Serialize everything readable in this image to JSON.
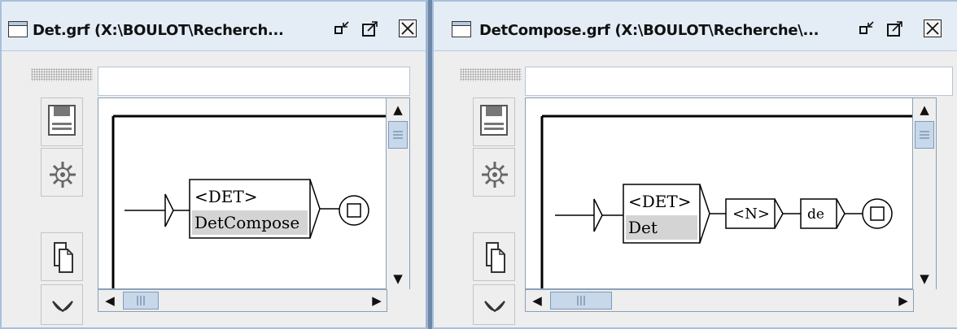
{
  "windows": [
    {
      "title": "Det.grf (X:\\BOULOT\\Recherch...",
      "controls": {
        "iconify": "▫↙",
        "maximize": "↗",
        "close": "×"
      },
      "graph": {
        "box_lines": [
          "<DET>",
          "DetCompose"
        ],
        "highlighted_line": "DetCompose"
      }
    },
    {
      "title": "DetCompose.grf (X:\\BOULOT\\Recherche\\...",
      "controls": {
        "iconify": "▫↙",
        "maximize": "↗",
        "close": "×"
      },
      "graph": {
        "box1_lines": [
          "<DET>",
          "Det"
        ],
        "highlighted_line": "Det",
        "box2": "<N>",
        "box3": "de"
      }
    }
  ],
  "toolbar": {
    "buttons": [
      "save-icon",
      "compile-icon",
      "copy-icon",
      "paste-icon"
    ]
  },
  "colors": {
    "titlebar": "#e4edf6",
    "window_border": "#a7c0db",
    "scroll_thumb": "#c7d8ea",
    "highlight": "#d4d4d4"
  }
}
